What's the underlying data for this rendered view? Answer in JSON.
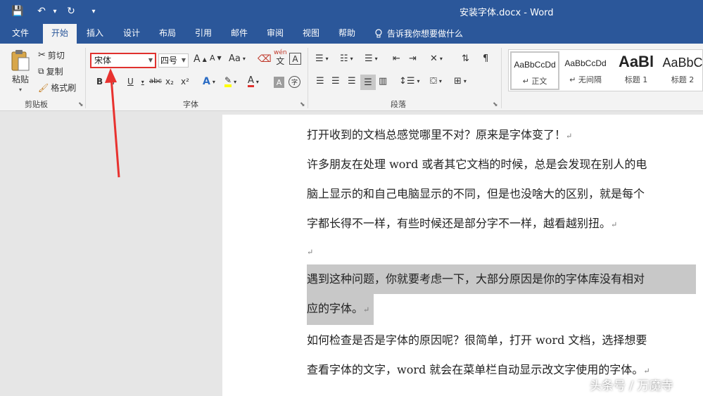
{
  "title": "安装字体.docx  -  Word",
  "qat": {
    "save_icon": "💾",
    "undo_icon": "↶",
    "undo_dropdown": "▾",
    "redo_icon": "↻",
    "customize_icon": "▾"
  },
  "tabs": [
    "文件",
    "开始",
    "插入",
    "设计",
    "布局",
    "引用",
    "邮件",
    "审阅",
    "视图",
    "帮助"
  ],
  "tell_me": "告诉我你想要做什么",
  "clipboard": {
    "paste": "粘贴",
    "cut": "剪切",
    "copy": "复制",
    "format_painter": "格式刷",
    "label": "剪贴板"
  },
  "font": {
    "name": "宋体",
    "size": "四号",
    "label": "字体",
    "grow": "A",
    "shrink": "A",
    "change_case": "Aa",
    "phonetic": "wén",
    "bold": "B",
    "italic": "I",
    "underline": "U",
    "strike": "abc",
    "subscript": "x₂",
    "superscript": "x²",
    "char_border": "A",
    "char_shading": "A",
    "enclosed": "字"
  },
  "paragraph": {
    "label": "段落"
  },
  "styles": [
    {
      "sample": "AaBbCcDd",
      "name": "正文"
    },
    {
      "sample": "AaBbCcDd",
      "name": "无间隔"
    },
    {
      "sample": "AaBl",
      "name": "标题 1"
    },
    {
      "sample": "AaBbC",
      "name": "标题 2"
    }
  ],
  "document": {
    "lines": [
      "打开收到的文档总感觉哪里不对？原来是字体变了！",
      "许多朋友在处理 word 或者其它文档的时候，总是会发现在别人的电",
      "脑上显示的和自己电脑显示的不同，但是也没啥大的区别，就是每个",
      "字都长得不一样，有些时候还是部分字不一样，越看越别扭。",
      "",
      "遇到这种问题，你就要考虑一下，大部分原因是你的字体库没有相对",
      "应的字体。",
      "如何检查是否是字体的原因呢？很简单，打开 word 文档，选择想要",
      "查看字体的文字，word 就会在菜单栏自动显示改文字使用的字体。"
    ],
    "para_mark": "↵"
  },
  "watermark": "头条号 / 万魔寺",
  "colors": {
    "ribbon_blue": "#2b579a",
    "highlight_red": "#e0312e",
    "font_color_red": "#e0312e",
    "highlighter_yellow": "#ffff00"
  }
}
